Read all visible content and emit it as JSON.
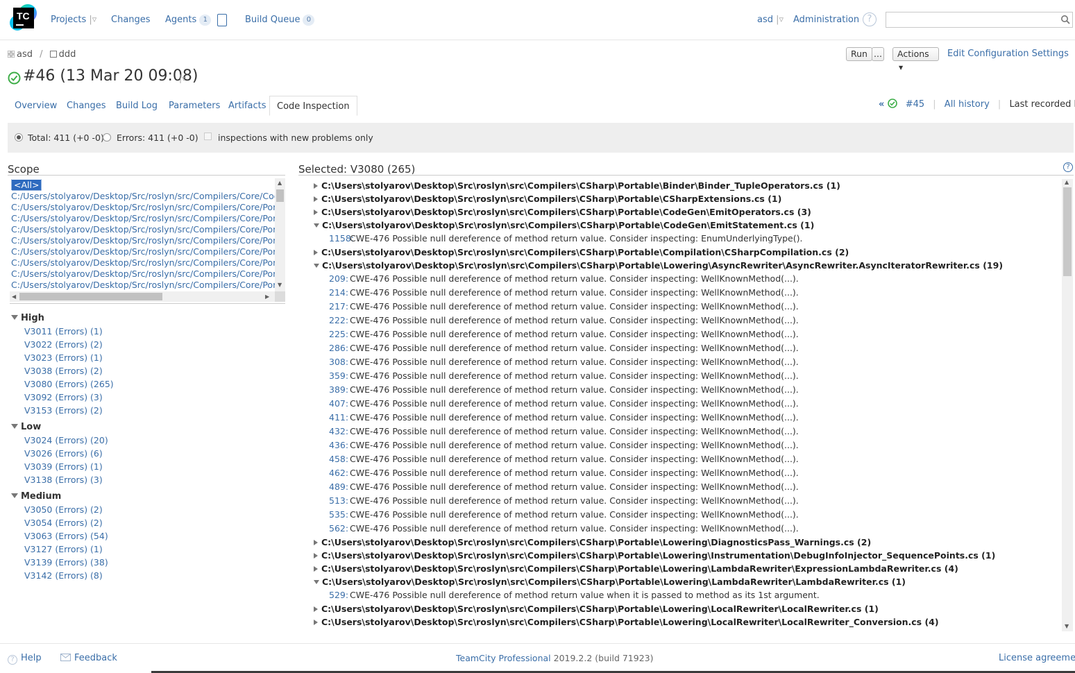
{
  "header": {
    "logo_text": "TC",
    "nav": {
      "projects": "Projects",
      "changes": "Changes",
      "agents": "Agents",
      "agents_count": "1",
      "build_queue": "Build Queue",
      "build_queue_count": "0"
    },
    "user": "asd",
    "administration": "Administration",
    "search_value": ""
  },
  "breadcrumb": {
    "project": "asd",
    "separator": "/",
    "config": "ddd"
  },
  "build": {
    "title": "#46 (13 Mar 20 09:08)",
    "run_label": "Run",
    "run_more_label": "...",
    "actions_label": "Actions",
    "edit_config_label": "Edit Configuration Settings"
  },
  "tabs": [
    "Overview",
    "Changes",
    "Build Log",
    "Parameters",
    "Artifacts",
    "Code Inspection"
  ],
  "active_tab": "Code Inspection",
  "history": {
    "prev_build": "#45",
    "all_history": "All history",
    "last_recorded": "Last recorded build"
  },
  "filter": {
    "total_label": "Total: 411 (+0 -0)",
    "errors_label": "Errors: 411 (+0 -0)",
    "new_only_label": "inspections with new problems only"
  },
  "scope": {
    "title": "Scope",
    "items": [
      "<All>",
      "C:/Users/stolyarov/Desktop/Src/roslyn/src/Compilers/Core/CodeAnalysisTest",
      "C:/Users/stolyarov/Desktop/Src/roslyn/src/Compilers/Core/Portable",
      "C:/Users/stolyarov/Desktop/Src/roslyn/src/Compilers/Core/Portable",
      "C:/Users/stolyarov/Desktop/Src/roslyn/src/Compilers/Core/Portable",
      "C:/Users/stolyarov/Desktop/Src/roslyn/src/Compilers/Core/Portable",
      "C:/Users/stolyarov/Desktop/Src/roslyn/src/Compilers/Core/Portable",
      "C:/Users/stolyarov/Desktop/Src/roslyn/src/Compilers/Core/Portable",
      "C:/Users/stolyarov/Desktop/Src/roslyn/src/Compilers/Core/Portable",
      "C:/Users/stolyarov/Desktop/Src/roslyn/src/Compilers/Core/Portable"
    ]
  },
  "inspections": [
    {
      "group": "High",
      "items": [
        "V3011 (Errors) (1)",
        "V3022 (Errors) (2)",
        "V3023 (Errors) (1)",
        "V3038 (Errors) (2)",
        "V3080 (Errors) (265)",
        "V3092 (Errors) (3)",
        "V3153 (Errors) (2)"
      ]
    },
    {
      "group": "Low",
      "items": [
        "V3024 (Errors) (20)",
        "V3026 (Errors) (6)",
        "V3039 (Errors) (1)",
        "V3138 (Errors) (3)"
      ]
    },
    {
      "group": "Medium",
      "items": [
        "V3050 (Errors) (2)",
        "V3054 (Errors) (2)",
        "V3063 (Errors) (54)",
        "V3127 (Errors) (1)",
        "V3139 (Errors) (38)",
        "V3142 (Errors) (8)"
      ]
    }
  ],
  "selected": {
    "title": "Selected: V3080 (265)",
    "rows": [
      {
        "kind": "file",
        "expanded": false,
        "text": "C:\\Users\\stolyarov\\Desktop\\Src\\roslyn\\src\\Compilers\\CSharp\\Portable\\Binder\\Binder_TupleOperators.cs (1)"
      },
      {
        "kind": "file",
        "expanded": false,
        "text": "C:\\Users\\stolyarov\\Desktop\\Src\\roslyn\\src\\Compilers\\CSharp\\Portable\\CSharpExtensions.cs (1)"
      },
      {
        "kind": "file",
        "expanded": false,
        "text": "C:\\Users\\stolyarov\\Desktop\\Src\\roslyn\\src\\Compilers\\CSharp\\Portable\\CodeGen\\EmitOperators.cs (3)"
      },
      {
        "kind": "file",
        "expanded": true,
        "text": "C:\\Users\\stolyarov\\Desktop\\Src\\roslyn\\src\\Compilers\\CSharp\\Portable\\CodeGen\\EmitStatement.cs (1)"
      },
      {
        "kind": "issue",
        "line": "1158:",
        "text": "CWE-476 Possible null dereference of method return value. Consider inspecting: EnumUnderlyingType()."
      },
      {
        "kind": "file",
        "expanded": false,
        "text": "C:\\Users\\stolyarov\\Desktop\\Src\\roslyn\\src\\Compilers\\CSharp\\Portable\\Compilation\\CSharpCompilation.cs (2)"
      },
      {
        "kind": "file",
        "expanded": true,
        "text": "C:\\Users\\stolyarov\\Desktop\\Src\\roslyn\\src\\Compilers\\CSharp\\Portable\\Lowering\\AsyncRewriter\\AsyncRewriter.AsyncIteratorRewriter.cs (19)"
      },
      {
        "kind": "issue",
        "line": "209:",
        "text": "CWE-476 Possible null dereference of method return value. Consider inspecting: WellKnownMethod(...)."
      },
      {
        "kind": "issue",
        "line": "214:",
        "text": "CWE-476 Possible null dereference of method return value. Consider inspecting: WellKnownMethod(...)."
      },
      {
        "kind": "issue",
        "line": "217:",
        "text": "CWE-476 Possible null dereference of method return value. Consider inspecting: WellKnownMethod(...)."
      },
      {
        "kind": "issue",
        "line": "222:",
        "text": "CWE-476 Possible null dereference of method return value. Consider inspecting: WellKnownMethod(...)."
      },
      {
        "kind": "issue",
        "line": "225:",
        "text": "CWE-476 Possible null dereference of method return value. Consider inspecting: WellKnownMethod(...)."
      },
      {
        "kind": "issue",
        "line": "286:",
        "text": "CWE-476 Possible null dereference of method return value. Consider inspecting: WellKnownMethod(...)."
      },
      {
        "kind": "issue",
        "line": "308:",
        "text": "CWE-476 Possible null dereference of method return value. Consider inspecting: WellKnownMethod(...)."
      },
      {
        "kind": "issue",
        "line": "359:",
        "text": "CWE-476 Possible null dereference of method return value. Consider inspecting: WellKnownMethod(...)."
      },
      {
        "kind": "issue",
        "line": "389:",
        "text": "CWE-476 Possible null dereference of method return value. Consider inspecting: WellKnownMethod(...)."
      },
      {
        "kind": "issue",
        "line": "407:",
        "text": "CWE-476 Possible null dereference of method return value. Consider inspecting: WellKnownMethod(...)."
      },
      {
        "kind": "issue",
        "line": "411:",
        "text": "CWE-476 Possible null dereference of method return value. Consider inspecting: WellKnownMethod(...)."
      },
      {
        "kind": "issue",
        "line": "432:",
        "text": "CWE-476 Possible null dereference of method return value. Consider inspecting: WellKnownMethod(...)."
      },
      {
        "kind": "issue",
        "line": "436:",
        "text": "CWE-476 Possible null dereference of method return value. Consider inspecting: WellKnownMethod(...)."
      },
      {
        "kind": "issue",
        "line": "458:",
        "text": "CWE-476 Possible null dereference of method return value. Consider inspecting: WellKnownMethod(...)."
      },
      {
        "kind": "issue",
        "line": "462:",
        "text": "CWE-476 Possible null dereference of method return value. Consider inspecting: WellKnownMethod(...)."
      },
      {
        "kind": "issue",
        "line": "489:",
        "text": "CWE-476 Possible null dereference of method return value. Consider inspecting: WellKnownMethod(...)."
      },
      {
        "kind": "issue",
        "line": "513:",
        "text": "CWE-476 Possible null dereference of method return value. Consider inspecting: WellKnownMethod(...)."
      },
      {
        "kind": "issue",
        "line": "535:",
        "text": "CWE-476 Possible null dereference of method return value. Consider inspecting: WellKnownMethod(...)."
      },
      {
        "kind": "issue",
        "line": "562:",
        "text": "CWE-476 Possible null dereference of method return value. Consider inspecting: WellKnownMethod(...)."
      },
      {
        "kind": "file",
        "expanded": false,
        "text": "C:\\Users\\stolyarov\\Desktop\\Src\\roslyn\\src\\Compilers\\CSharp\\Portable\\Lowering\\DiagnosticsPass_Warnings.cs (2)"
      },
      {
        "kind": "file",
        "expanded": false,
        "text": "C:\\Users\\stolyarov\\Desktop\\Src\\roslyn\\src\\Compilers\\CSharp\\Portable\\Lowering\\Instrumentation\\DebugInfoInjector_SequencePoints.cs (1)"
      },
      {
        "kind": "file",
        "expanded": false,
        "text": "C:\\Users\\stolyarov\\Desktop\\Src\\roslyn\\src\\Compilers\\CSharp\\Portable\\Lowering\\LambdaRewriter\\ExpressionLambdaRewriter.cs (4)"
      },
      {
        "kind": "file",
        "expanded": true,
        "text": "C:\\Users\\stolyarov\\Desktop\\Src\\roslyn\\src\\Compilers\\CSharp\\Portable\\Lowering\\LambdaRewriter\\LambdaRewriter.cs (1)"
      },
      {
        "kind": "issue",
        "line": "529:",
        "text": "CWE-476 Possible null dereference of method return value when it is passed to method as its 1st argument."
      },
      {
        "kind": "file",
        "expanded": false,
        "text": "C:\\Users\\stolyarov\\Desktop\\Src\\roslyn\\src\\Compilers\\CSharp\\Portable\\Lowering\\LocalRewriter\\LocalRewriter.cs (1)"
      },
      {
        "kind": "file",
        "expanded": false,
        "text": "C:\\Users\\stolyarov\\Desktop\\Src\\roslyn\\src\\Compilers\\CSharp\\Portable\\Lowering\\LocalRewriter\\LocalRewriter_Conversion.cs (4)"
      }
    ]
  },
  "footer": {
    "help": "Help",
    "feedback": "Feedback",
    "product_link": "TeamCity Professional",
    "version": "2019.2.2 (build 71923)",
    "license": "License agreement"
  },
  "colors": {
    "link": "#3a6ea8",
    "success": "#3fae49",
    "selection": "#2d6abf"
  }
}
